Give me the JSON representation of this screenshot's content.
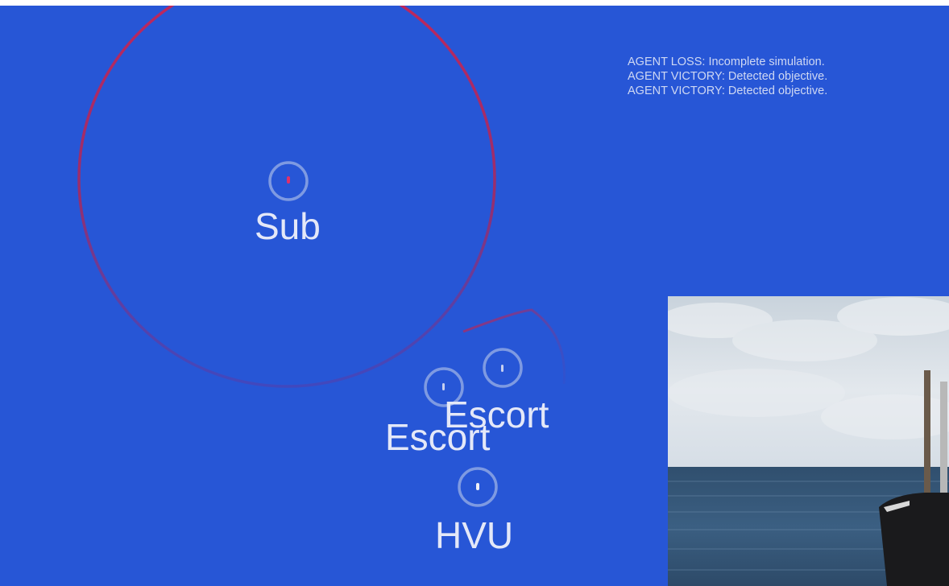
{
  "colors": {
    "frame": "#ffffff",
    "ocean": "#2756d6",
    "range_ring": "#b5285c",
    "unit_ring": "#8ea6e4",
    "unit_text": "#e4e8f8",
    "log_text": "#cfd8f3"
  },
  "units": [
    {
      "label": "Sub",
      "marker": "red-dot"
    },
    {
      "label": "Escort",
      "marker": "dash"
    },
    {
      "label": "Escort",
      "marker": "dash"
    },
    {
      "label": "HVU",
      "marker": "dash"
    }
  ],
  "log": {
    "lines": [
      "AGENT LOSS: Incomplete simulation.",
      "AGENT VICTORY: Detected objective.",
      "AGENT VICTORY: Detected objective."
    ]
  },
  "photo": {
    "subject": "submarine-sail-at-sea"
  }
}
